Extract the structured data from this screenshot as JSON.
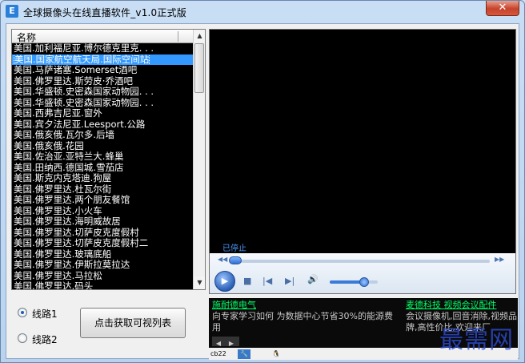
{
  "window": {
    "title": "全球摄像头在线直播软件_v1.0正式版",
    "close_glyph": "✕",
    "app_icon_glyph": "E"
  },
  "channel_list": {
    "column_header": "名称",
    "selected_index": 1,
    "items": [
      "美国.加利福尼亚.博尔德克里克. . .",
      "美国.国家航空航天局.国际空间站",
      "美国.马萨诸塞.Somerset酒吧",
      "美国.佛罗里达.斯劳皮·乔酒吧",
      "美国.华盛顿.史密森国家动物园. . .",
      "美国.华盛顿.史密森国家动物园. . .",
      "美国.西弗吉尼亚.窗外",
      "美国.宾夕法尼亚.Leesport.公路",
      "美国.俄亥俄.瓦尔多.后墙",
      "美国.俄亥俄.花园",
      "美国.佐治亚.亚特兰大.蜂巢",
      "美国.田纳西.德国城.雪茄店",
      "美国.斯克内克塔迪.狗屋",
      "美国.佛罗里达.杜瓦尔街",
      "美国.佛罗里达.两个朋友餐馆",
      "美国.佛罗里达.小火车",
      "美国.佛罗里达.海明威故居",
      "美国.佛罗里达.切萨皮克度假村",
      "美国.佛罗里达.切萨皮克度假村二",
      "美国.佛罗里达.玻璃底船",
      "美国.佛罗里达.伊斯拉莫拉达",
      "美国.佛罗里达.马拉松",
      "美国.佛罗里达.码头"
    ]
  },
  "routes": [
    {
      "label": "线路1",
      "selected": true
    },
    {
      "label": "线路2",
      "selected": false
    }
  ],
  "fetch_button": "点击获取可视列表",
  "player": {
    "status": "已停止",
    "progress_fraction": 0.0,
    "volume_fraction": 0.72,
    "play_glyph": "▶",
    "stop_glyph": "■",
    "prev_glyph": "|◀",
    "next_glyph": "▶|",
    "volume_glyph": "🔊",
    "seek_back_glyph": "◀◀",
    "seek_fwd_glyph": "▶▶"
  },
  "ads": [
    {
      "title": "施耐德电气",
      "body": "向专家学习如何 为数据中心节省30%的能源费用"
    },
    {
      "title": "麦德科技 视频会议配件",
      "body": "会议摄像机,回音消除,视频品牌,高性价比,欢迎来厂"
    }
  ],
  "ad_nav": {
    "prev": "◀",
    "next": "▶"
  },
  "tray": [
    "cb22",
    "🔧",
    "🐧"
  ],
  "watermark": "最需网",
  "colors": {
    "selection": "#3399ff",
    "ad_title": "#00ff66",
    "status_text": "#4b9bff",
    "watermark": "#2f4fd8"
  }
}
